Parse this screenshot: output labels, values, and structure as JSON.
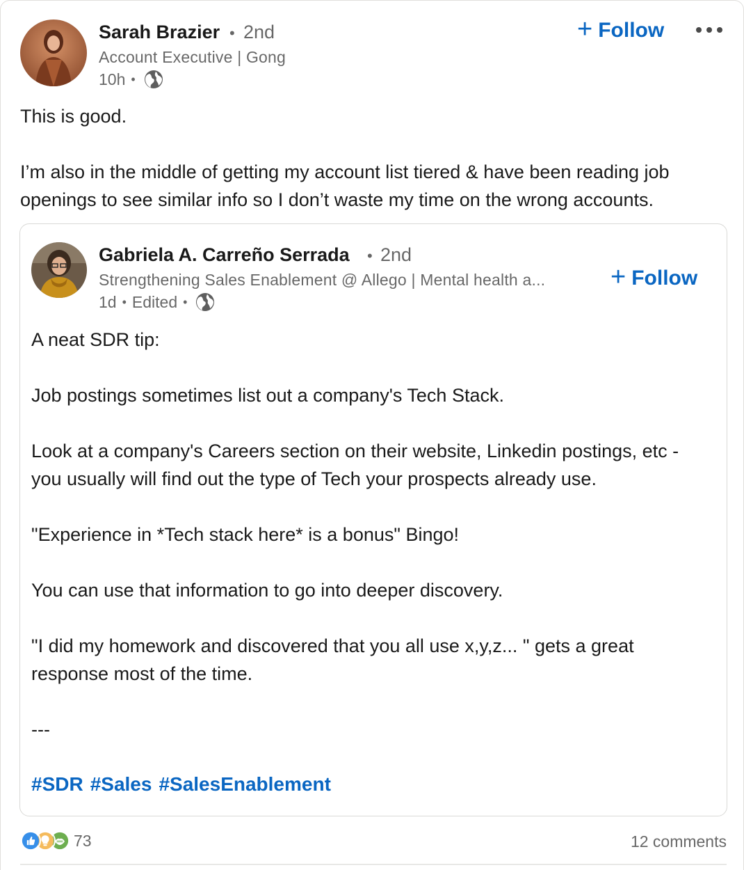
{
  "post": {
    "author": {
      "name": "Sarah Brazier",
      "degree": "2nd",
      "headline": "Account Executive | Gong",
      "time": "10h"
    },
    "follow_label": "Follow",
    "paragraphs": [
      "This is good.",
      "I’m also in the middle of getting my account list tiered & have been reading job openings to see similar info so I don’t waste my time on the wrong accounts."
    ]
  },
  "shared": {
    "author": {
      "name": "Gabriela A. Carreño Serrada",
      "degree": "2nd",
      "headline": "Strengthening Sales Enablement @ Allego | Mental health a...",
      "time": "1d",
      "edited": "Edited"
    },
    "follow_label": "Follow",
    "paragraphs": [
      "A neat SDR tip:",
      "Job postings sometimes list out a company's Tech Stack.",
      "Look at a company's Careers section on their website, Linkedin postings, etc - you usually will find out the type of Tech your prospects already use.",
      "\"Experience in *Tech stack here* is a bonus\" Bingo!",
      "You can use that information to go into deeper discovery.",
      "\"I did my homework and discovered that you all use x,y,z... \" gets a great response most of the time.",
      "---"
    ],
    "hashtags": [
      "#SDR",
      "#Sales",
      "#SalesEnablement"
    ]
  },
  "social": {
    "reaction_count": "73",
    "comments": "12 comments",
    "reaction_icons": [
      "like-icon",
      "insightful-icon",
      "support-icon"
    ]
  },
  "colors": {
    "link": "#0a66c2",
    "text": "#000000e6",
    "muted": "#00000099",
    "like": "#378fe9",
    "insightful": "#f5bb5c",
    "support": "#6dae4f"
  }
}
